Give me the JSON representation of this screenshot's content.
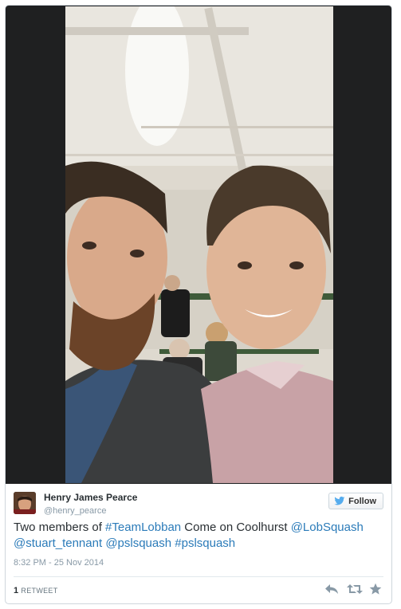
{
  "tweet": {
    "author_name": "Henry James Pearce",
    "author_handle": "@henry_pearce",
    "follow_label": "Follow",
    "text_parts": {
      "t1": "Two members of ",
      "l1": "#TeamLobban",
      "t2": " Come on Coolhurst ",
      "l2": "@LobSquash",
      "l3": "@stuart_tennant",
      "t3": " ",
      "l4": "@pslsquash",
      "t4": " ",
      "l5": "#pslsquash"
    },
    "timestamp": "8:32 PM - 25 Nov 2014",
    "retweet_count": "1",
    "retweet_label": "RETWEET"
  },
  "icons": {
    "follow": "twitter-bird-icon",
    "reply": "reply-icon",
    "retweet": "retweet-icon",
    "favorite": "star-icon"
  },
  "colors": {
    "link": "#2b7bb9",
    "meta": "#8899a6",
    "media_background": "#1f2021"
  }
}
